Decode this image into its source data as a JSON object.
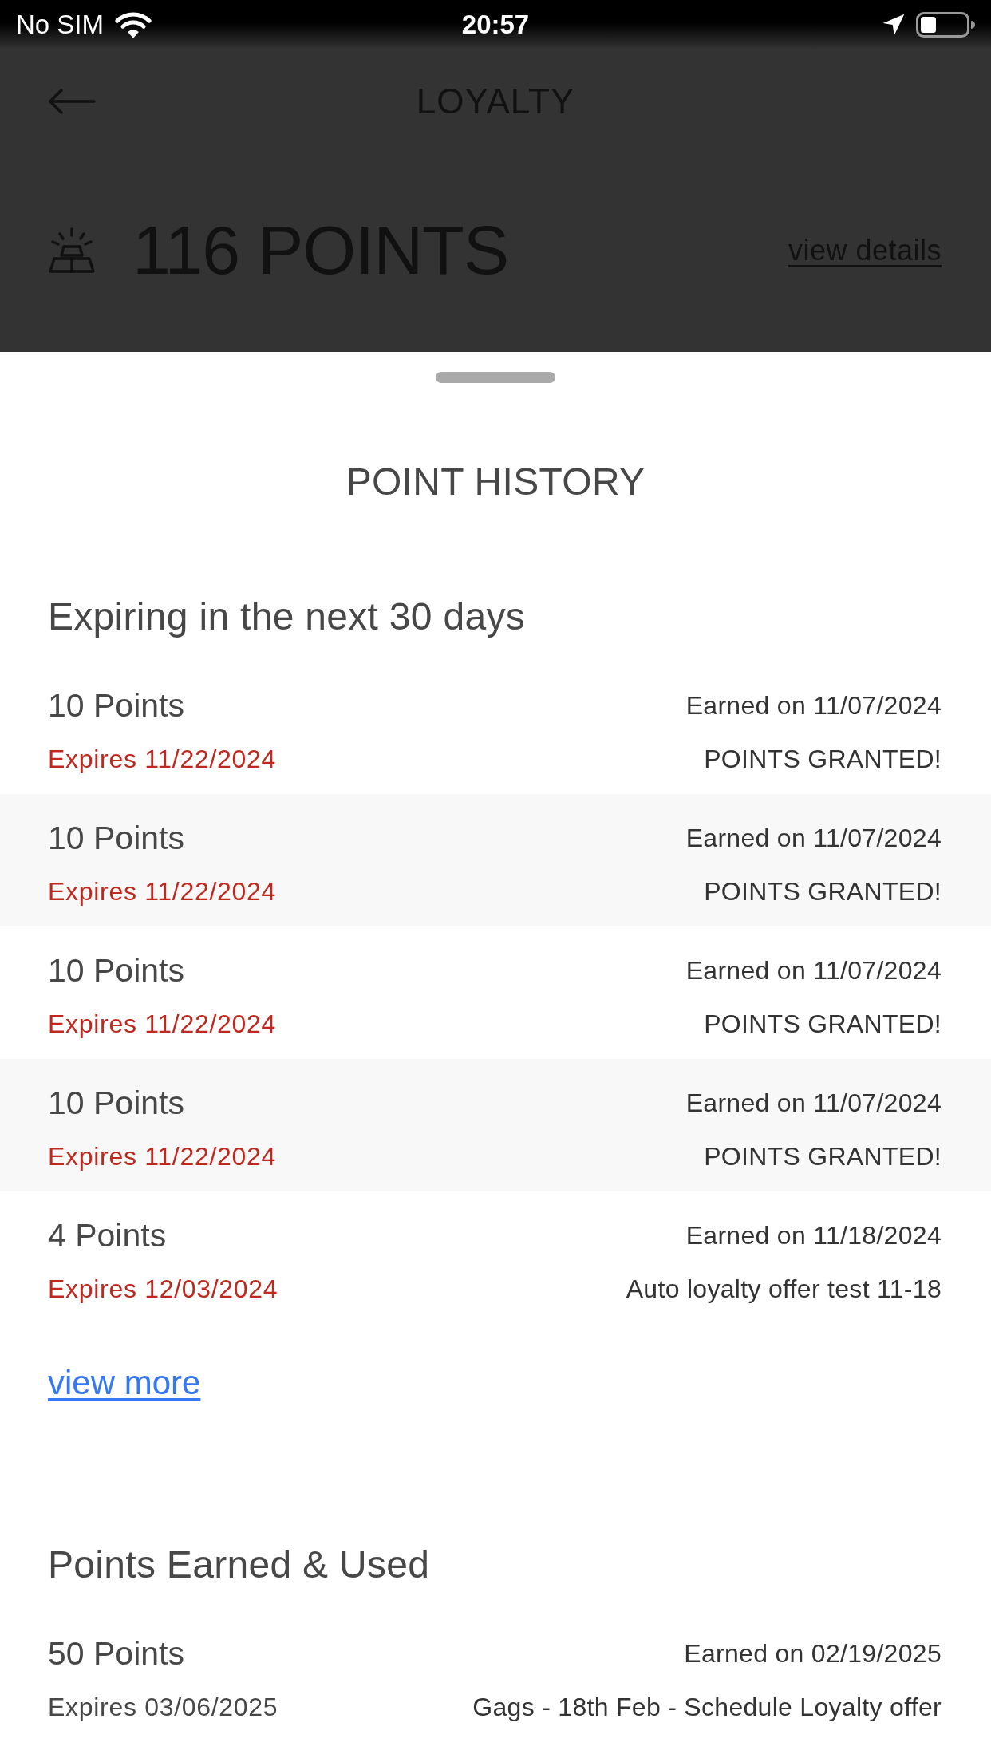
{
  "status_bar": {
    "carrier": "No SIM",
    "time": "20:57"
  },
  "header": {
    "title": "LOYALTY",
    "points": "116 POINTS",
    "details_link": "view details"
  },
  "sheet": {
    "title": "POINT HISTORY",
    "sections": [
      {
        "kind": "expiring",
        "heading": "Expiring in the next 30 days",
        "items": [
          {
            "points": "10 Points",
            "expires": "Expires 11/22/2024",
            "earned": "Earned on 11/07/2024",
            "description": "POINTS GRANTED!"
          },
          {
            "points": "10 Points",
            "expires": "Expires 11/22/2024",
            "earned": "Earned on 11/07/2024",
            "description": "POINTS GRANTED!"
          },
          {
            "points": "10 Points",
            "expires": "Expires 11/22/2024",
            "earned": "Earned on 11/07/2024",
            "description": "POINTS GRANTED!"
          },
          {
            "points": "10 Points",
            "expires": "Expires 11/22/2024",
            "earned": "Earned on 11/07/2024",
            "description": "POINTS GRANTED!"
          },
          {
            "points": "4 Points",
            "expires": "Expires 12/03/2024",
            "earned": "Earned on 11/18/2024",
            "description": "Auto loyalty offer test 11-18"
          }
        ],
        "link": "view more"
      },
      {
        "kind": "history",
        "heading": "Points Earned & Used",
        "items": [
          {
            "points": "50 Points",
            "expires": "Expires 03/06/2025",
            "earned": "Earned on 02/19/2025",
            "description": "Gags - 18th Feb - Schedule Loyalty offer"
          }
        ]
      }
    ]
  }
}
